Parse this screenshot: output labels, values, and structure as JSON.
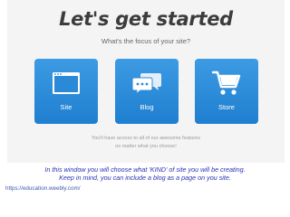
{
  "page": {
    "heading": "Let's get started",
    "subheading": "What's the focus of your site?"
  },
  "cards": [
    {
      "label": "Site",
      "icon": "browser-window-icon"
    },
    {
      "label": "Blog",
      "icon": "speech-bubbles-icon"
    },
    {
      "label": "Store",
      "icon": "shopping-cart-icon"
    }
  ],
  "note": {
    "line1": "You'll have access to all of our awesome features",
    "line2": "no matter what you choose!"
  },
  "caption": {
    "line1": "In this window you will choose what 'KIND' of site you will be creating.",
    "line2": "Keep in mind, you can include a blog as a page on you site."
  },
  "source_link": "https://education.weebly.com/",
  "colors": {
    "card_blue": "#2a8ad8",
    "caption_blue": "#2b33b4",
    "background": "#f4f4f4"
  }
}
